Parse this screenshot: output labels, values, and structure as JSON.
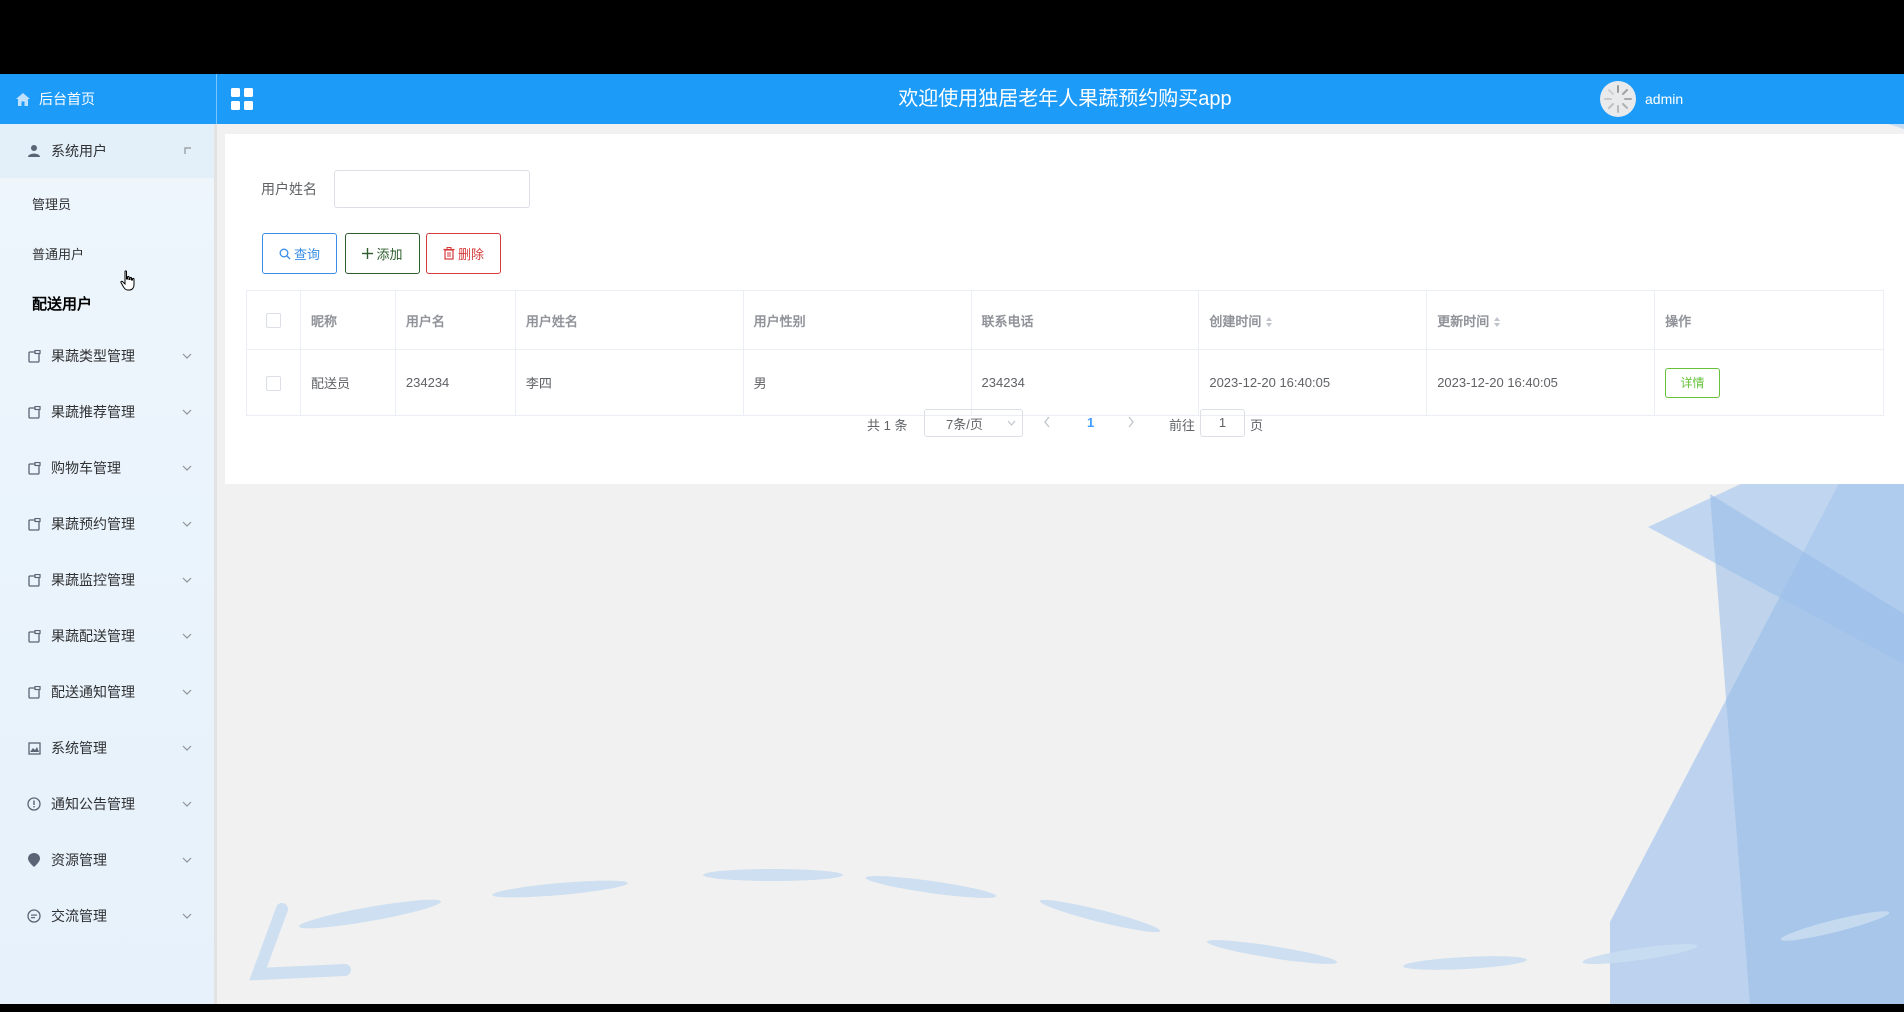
{
  "header": {
    "home_label": "后台首页",
    "title": "欢迎使用独居老年人果蔬预约购买app",
    "username": "admin"
  },
  "sidebar": {
    "open_group": "系统用户",
    "sub_items": [
      "管理员",
      "普通用户",
      "配送用户"
    ],
    "items": [
      {
        "label": "果蔬类型管理"
      },
      {
        "label": "果蔬推荐管理"
      },
      {
        "label": "购物车管理"
      },
      {
        "label": "果蔬预约管理"
      },
      {
        "label": "果蔬监控管理"
      },
      {
        "label": "果蔬配送管理"
      },
      {
        "label": "配送通知管理"
      },
      {
        "label": "系统管理"
      },
      {
        "label": "通知公告管理"
      },
      {
        "label": "资源管理"
      },
      {
        "label": "交流管理"
      }
    ]
  },
  "search": {
    "label": "用户姓名",
    "value": "",
    "query_label": "查询",
    "add_label": "添加",
    "delete_label": "删除"
  },
  "table": {
    "headers": [
      "昵称",
      "用户名",
      "用户姓名",
      "用户性别",
      "联系电话",
      "创建时间",
      "更新时间",
      "操作"
    ],
    "rows": [
      {
        "nickname": "配送员",
        "username": "234234",
        "real_name": "李四",
        "gender": "男",
        "phone": "234234",
        "created": "2023-12-20 16:40:05",
        "updated": "2023-12-20 16:40:05",
        "action": "详情"
      }
    ]
  },
  "pagination": {
    "total_text": "共 1 条",
    "page_size": "7条/页",
    "current_page": "1",
    "goto_label": "前往",
    "goto_value": "1",
    "goto_unit": "页"
  },
  "colors": {
    "header_bg": "#1d9bf8",
    "sidebar_bg": "#eef6fc",
    "query": "#3a8ee6",
    "add": "#2e5d2e",
    "delete": "#d63a3a",
    "detail": "#67c23a"
  }
}
